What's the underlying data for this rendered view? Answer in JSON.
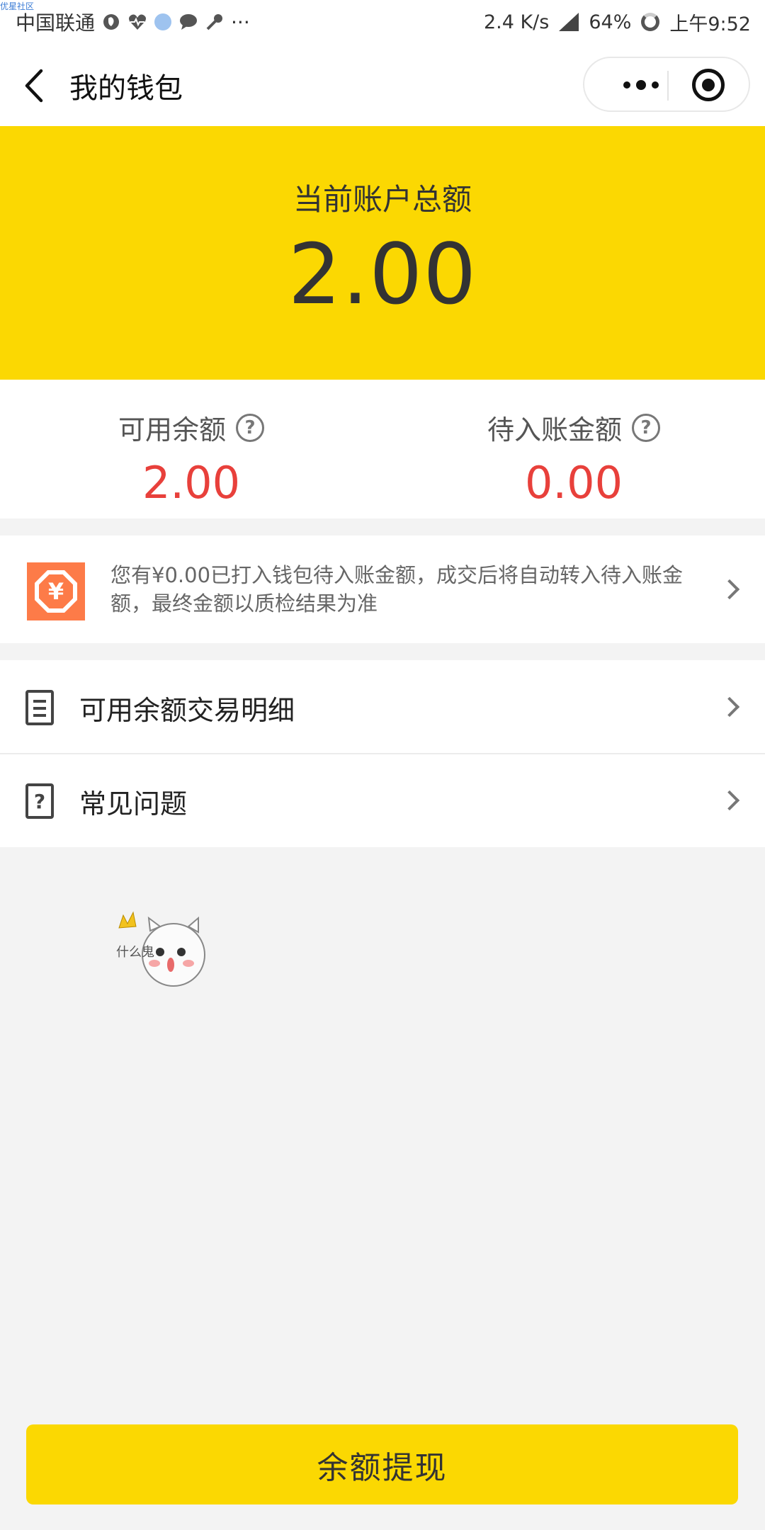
{
  "status_bar": {
    "watermark": "优星社区",
    "carrier": "中国联通",
    "more": "···",
    "net_speed": "2.4 K/s",
    "battery": "64%",
    "time": "上午9:52"
  },
  "nav": {
    "title": "我的钱包"
  },
  "account": {
    "total_label": "当前账户总额",
    "total_amount": "2.00",
    "available_label": "可用余额",
    "available_amount": "2.00",
    "pending_label": "待入账金额",
    "pending_amount": "0.00",
    "help_glyph": "?"
  },
  "notice": {
    "currency_glyph": "¥",
    "text": "您有¥0.00已打入钱包待入账金额，成交后将自动转入待入账金额，最终金额以质检结果为准"
  },
  "menu": {
    "items": [
      {
        "label": "可用余额交易明细",
        "icon": "document-icon"
      },
      {
        "label": "常见问题",
        "icon": "question-icon",
        "glyph": "?"
      }
    ]
  },
  "sticker": {
    "caption": "什么鬼"
  },
  "actions": {
    "withdraw_label": "余额提现"
  },
  "colors": {
    "brand_yellow": "#fbd802",
    "amount_red": "#e8403b",
    "notice_orange": "#fd7b48",
    "page_bg": "#f3f3f3"
  }
}
